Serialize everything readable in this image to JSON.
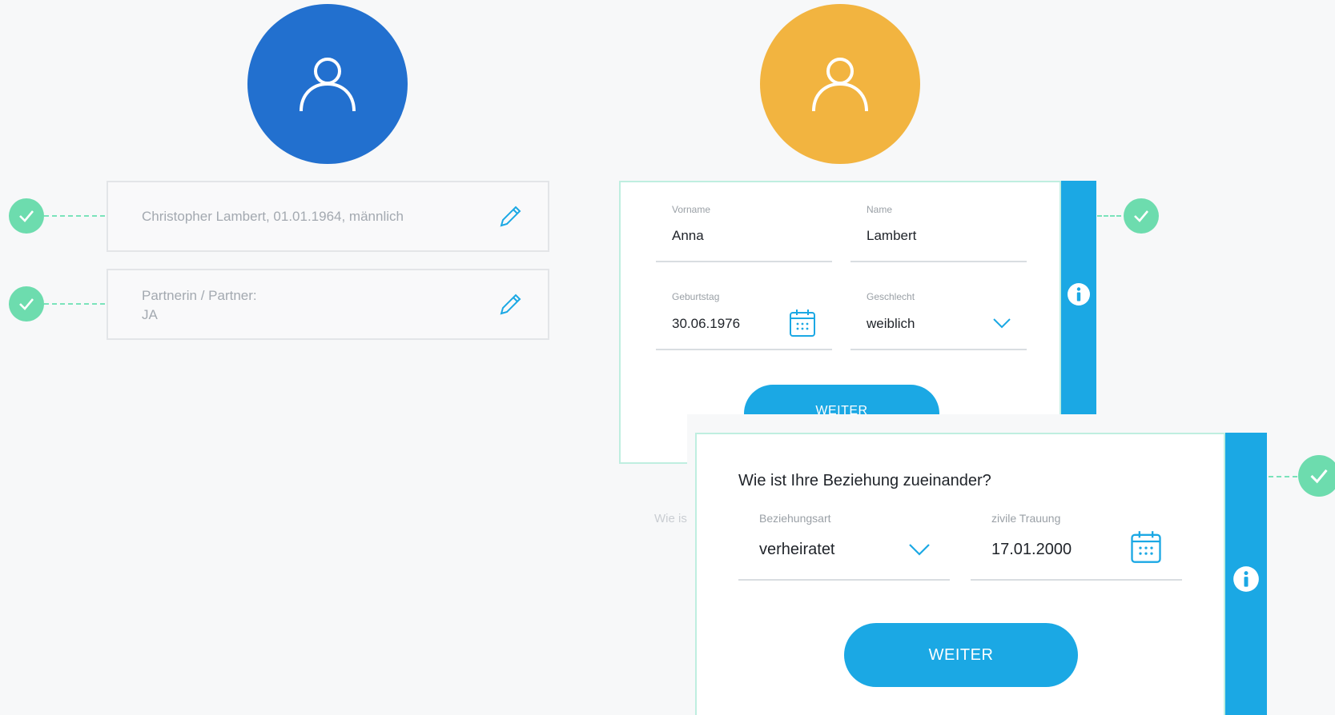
{
  "summary": {
    "person_line": "Christopher Lambert, 01.01.1964, männlich",
    "partner_label": "Partnerin / Partner:",
    "partner_value": "JA"
  },
  "partner_form": {
    "firstname": {
      "label": "Vorname",
      "value": "Anna"
    },
    "lastname": {
      "label": "Name",
      "value": "Lambert"
    },
    "birthday": {
      "label": "Geburtstag",
      "value": "30.06.1976"
    },
    "gender": {
      "label": "Geschlecht",
      "value": "weiblich"
    },
    "next_button": "WEITER",
    "faded_text": "Wie is"
  },
  "relationship_form": {
    "question": "Wie ist Ihre Beziehung zueinander?",
    "type": {
      "label": "Beziehungsart",
      "value": "verheiratet"
    },
    "civil_wedding": {
      "label": "zivile Trauung",
      "value": "17.01.2000"
    },
    "next_button": "WEITER"
  },
  "colors": {
    "primary_blue": "#2270cf",
    "accent_orange": "#f2b440",
    "accent_cyan": "#1ba8e4",
    "check_green": "#6ddcae"
  },
  "icons": [
    "user-icon",
    "check-icon",
    "pencil-icon",
    "calendar-icon",
    "chevron-down-icon",
    "info-icon"
  ]
}
